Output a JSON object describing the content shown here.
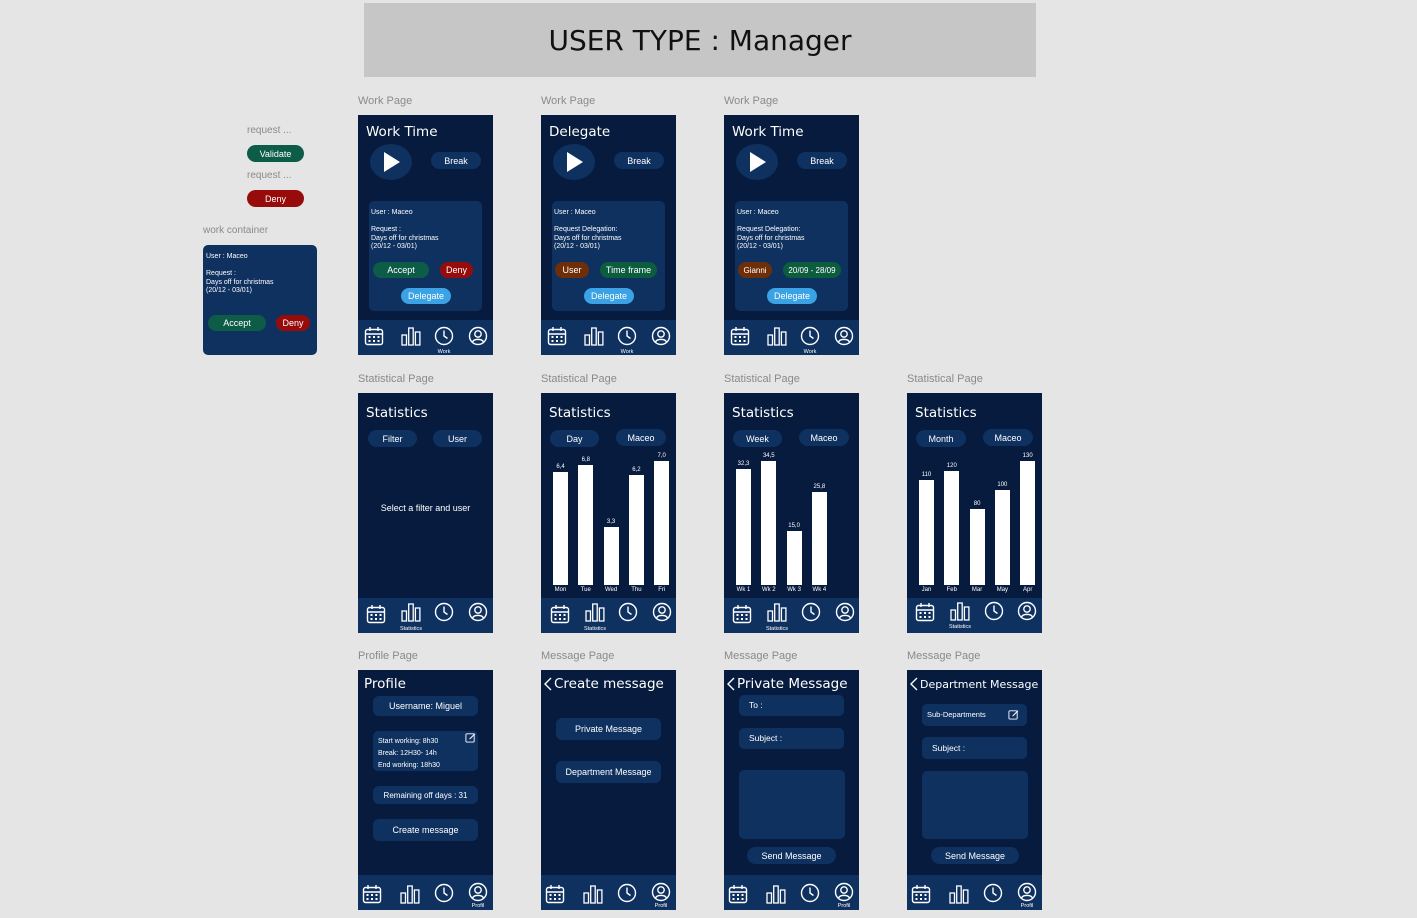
{
  "banner": {
    "title": "USER TYPE :  Manager"
  },
  "labels": {
    "work_page": "Work Page",
    "statistical_page": "Statistical Page",
    "profile_page": "Profile Page",
    "message_page": "Message Page",
    "request": "request ...",
    "work_container": "work container"
  },
  "components": {
    "validate": "Validate",
    "deny": "Deny",
    "container_text": "User : Maceo\n\nRequest :\nDays off for christmas\n(20/12 - 03/01)",
    "accept": "Accept"
  },
  "nav": {
    "work": "Work",
    "statistics": "Statistics",
    "profil": "Profil"
  },
  "work1": {
    "title": "Work Time",
    "break": "Break",
    "card_text": "User : Maceo\n\nRequest :\nDays off for christmas\n(20/12 - 03/01)",
    "accept": "Accept",
    "deny": "Deny",
    "delegate": "Delegate"
  },
  "work2": {
    "title": "Delegate",
    "break": "Break",
    "card_text": "User : Maceo\n\nRequest Delegation:\nDays off for christmas\n(20/12 - 03/01)",
    "user": "User",
    "timeframe": "Time frame",
    "delegate": "Delegate"
  },
  "work3": {
    "title": "Work Time",
    "break": "Break",
    "card_text": "User : Maceo\n\nRequest Delegation:\nDays off for christmas\n(20/12 - 03/01)",
    "user": "Gianni",
    "timeframe": "20/09 - 28/09",
    "delegate": "Delegate"
  },
  "stats1": {
    "title": "Statistics",
    "filter": "Filter",
    "user": "User",
    "message": "Select a filter and user"
  },
  "stats2": {
    "title": "Statistics",
    "filter": "Day",
    "user": "Maceo",
    "chart_data": {
      "type": "bar",
      "categories": [
        "Mon",
        "Tue",
        "Wed",
        "Thu",
        "Fri"
      ],
      "values": [
        6.4,
        6.8,
        3.3,
        6.2,
        7.0
      ],
      "value_labels": [
        "6,4",
        "6,8",
        "3,3",
        "6,2",
        "7,0"
      ]
    }
  },
  "stats3": {
    "title": "Statistics",
    "filter": "Week",
    "user": "Maceo",
    "chart_data": {
      "type": "bar",
      "categories": [
        "Wk 1",
        "Wk 2",
        "Wk 3",
        "Wk 4"
      ],
      "values": [
        32.3,
        34.5,
        15.0,
        25.8
      ],
      "value_labels": [
        "32,3",
        "34,5",
        "15,0",
        "25,8"
      ]
    }
  },
  "stats4": {
    "title": "Statistics",
    "filter": "Month",
    "user": "Maceo",
    "chart_data": {
      "type": "bar",
      "categories": [
        "Jan",
        "Feb",
        "Mar",
        "May",
        "Apr"
      ],
      "values": [
        110,
        120,
        80,
        100,
        130
      ],
      "value_labels": [
        "110",
        "120",
        "80",
        "100",
        "130"
      ]
    }
  },
  "profile": {
    "title": "Profile",
    "username": "Username: Miguel",
    "hours": "Start working: 8h30\nBreak: 12H30- 14h\nEnd working: 18h30",
    "remaining": "Remaining off days : 31",
    "create": "Create message"
  },
  "msg1": {
    "title": "Create message",
    "private": "Private Message",
    "department": "Department Message"
  },
  "msg2": {
    "title": "Private Message",
    "to": "To :",
    "subject": "Subject :",
    "send": "Send Message"
  },
  "msg3": {
    "title": "Department Message",
    "sub": "Sub-Departments",
    "subject": "Subject :",
    "send": "Send Message"
  }
}
